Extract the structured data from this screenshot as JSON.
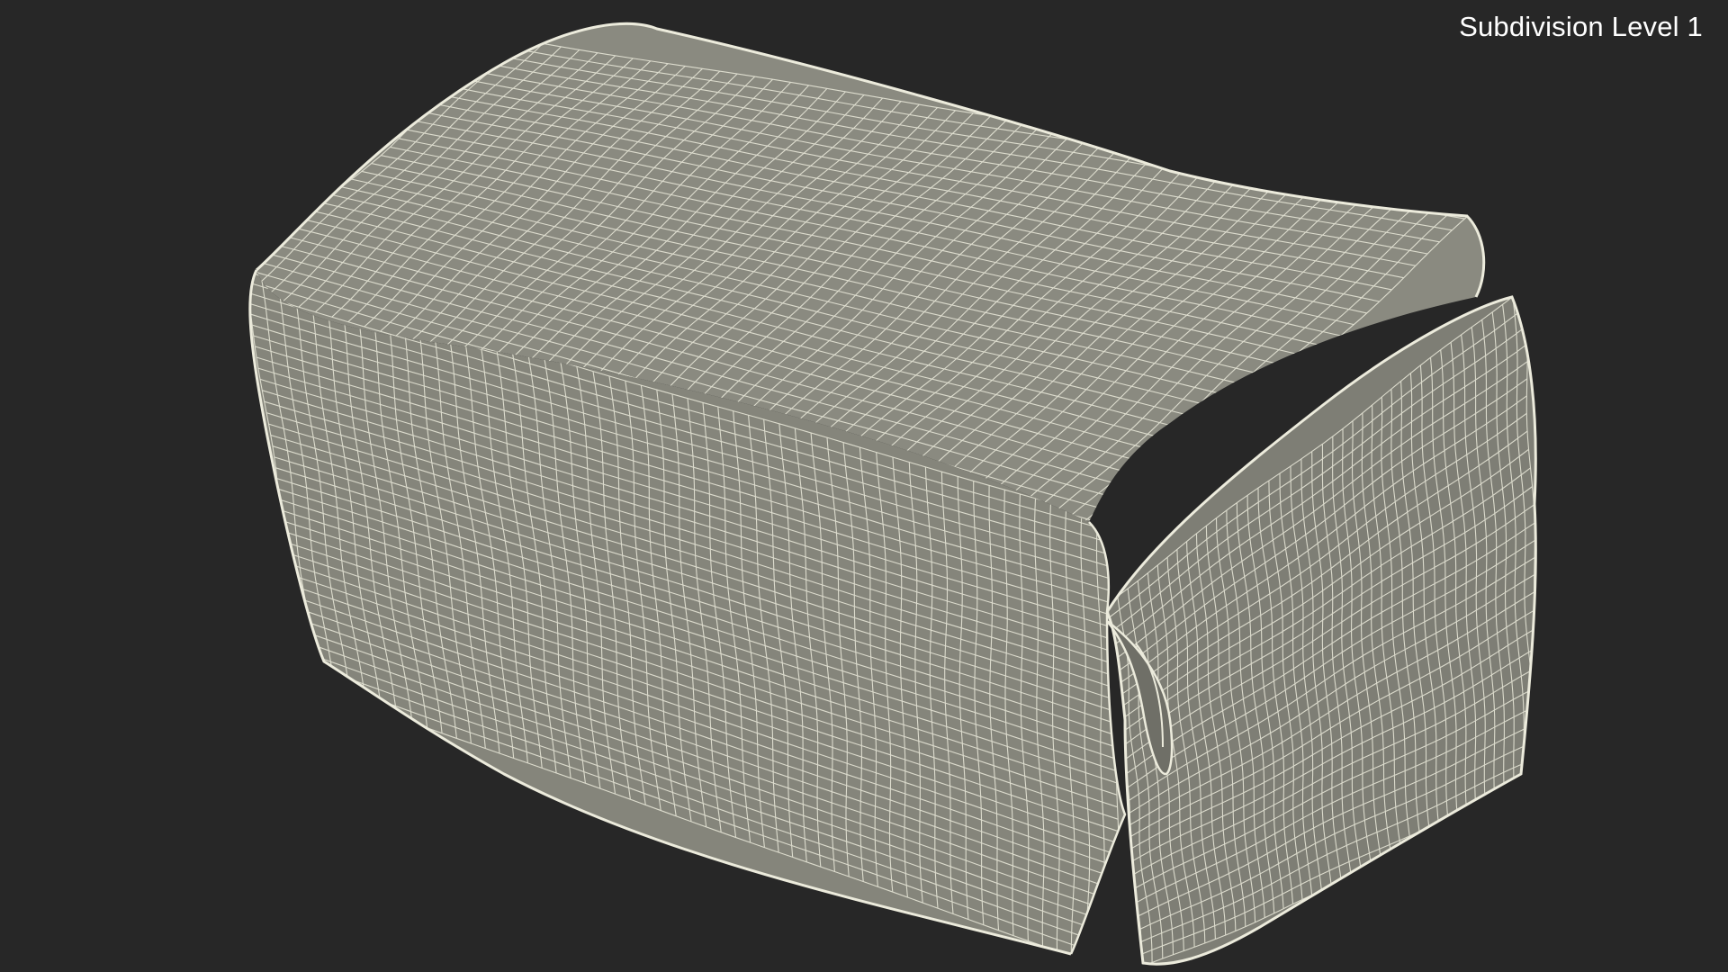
{
  "viewport": {
    "label": "Subdivision Level 1"
  },
  "colors": {
    "background": "#272727",
    "mesh_fill": "#87877d",
    "mesh_fill_shadow": "#707068",
    "wire": "#ecebdc"
  },
  "model": {
    "name": "wrapped-package-wireframe",
    "style": "wireframe-on-shaded"
  }
}
